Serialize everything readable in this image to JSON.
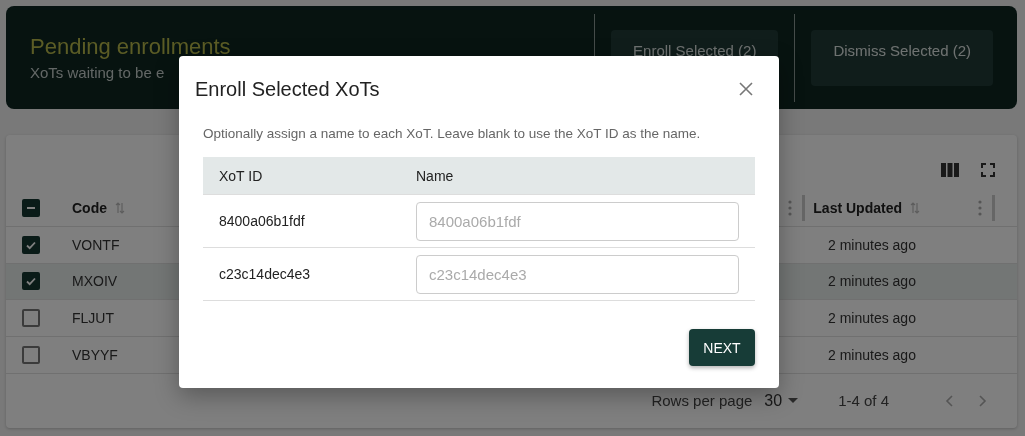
{
  "header": {
    "title": "Pending enrollments",
    "subtitle": "XoTs waiting to be e",
    "buttons": [
      {
        "label": "Enroll Selected (2)"
      },
      {
        "label": "Dismiss Selected (2)"
      }
    ]
  },
  "table": {
    "select_all": {
      "indeterminate": true
    },
    "columns": [
      {
        "label": "Code"
      },
      {
        "label": "Last Updated"
      }
    ],
    "rows": [
      {
        "code": "VONTF",
        "updated": "2 minutes ago",
        "checked": true,
        "selected": false
      },
      {
        "code": "MXOIV",
        "updated": "2 minutes ago",
        "checked": true,
        "selected": true
      },
      {
        "code": "FLJUT",
        "updated": "2 minutes ago",
        "checked": false,
        "selected": false
      },
      {
        "code": "VBYYF",
        "updated": "2 minutes ago",
        "checked": false,
        "selected": false
      }
    ],
    "footer": {
      "rows_per_page_label": "Rows per page",
      "rows_per_page": "30",
      "range": "1-4 of 4"
    }
  },
  "dialog": {
    "title": "Enroll Selected XoTs",
    "description": "Optionally assign a name to each XoT. Leave blank to use the XoT ID as the name.",
    "columns": [
      "XoT ID",
      "Name"
    ],
    "rows": [
      {
        "id": "8400a06b1fdf",
        "placeholder": "8400a06b1fdf"
      },
      {
        "id": "c23c14dec4e3",
        "placeholder": "c23c14dec4e3"
      }
    ],
    "button": "NEXT"
  }
}
